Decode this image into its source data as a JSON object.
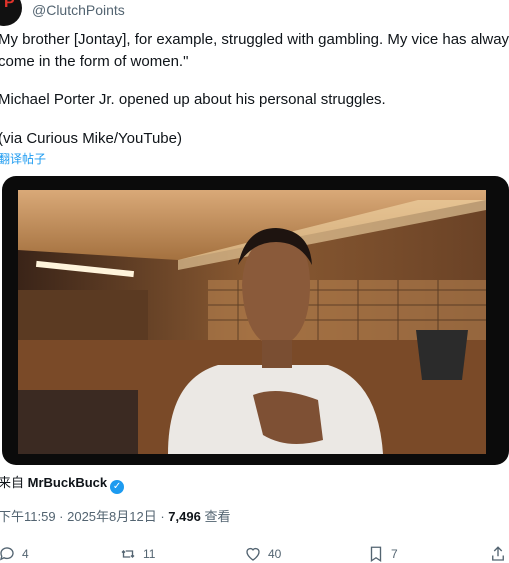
{
  "author": {
    "handle": "@ClutchPoints"
  },
  "tweet": {
    "line1": "My brother [Jontay], for example, struggled with gambling. My vice has always",
    "line2": "come in the form of women.\"",
    "line3": "Michael Porter Jr. opened up about his personal struggles.",
    "line4": "(via Curious Mike/YouTube)",
    "translate": "翻译帖子"
  },
  "media": {
    "source_prefix": "来自",
    "source_name": "MrBuckBuck"
  },
  "meta": {
    "time": "下午11:59 · 2025年8月12日 · ",
    "views": "7,496",
    "views_label": " 查看"
  },
  "actions": {
    "replies": "4",
    "reposts": "11",
    "likes": "40",
    "bookmarks": "7"
  },
  "colors": {
    "accent": "#1d9bf0",
    "brand": "#e0332b"
  }
}
